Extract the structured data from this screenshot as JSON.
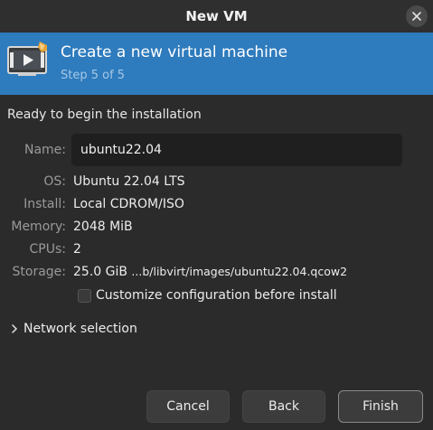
{
  "window": {
    "title": "New VM",
    "close_icon": "close-icon"
  },
  "banner": {
    "title": "Create a new virtual machine",
    "step": "Step 5 of 5",
    "icon": "virtual-machine-monitor-icon",
    "color": "#2e7bbd"
  },
  "summary": {
    "heading": "Ready to begin the installation",
    "name_label": "Name:",
    "name_value": "ubuntu22.04",
    "os_label": "OS:",
    "os_value": "Ubuntu 22.04 LTS",
    "install_label": "Install:",
    "install_value": "Local CDROM/ISO",
    "memory_label": "Memory:",
    "memory_value": "2048 MiB",
    "cpus_label": "CPUs:",
    "cpus_value": "2",
    "storage_label": "Storage:",
    "storage_size": "25.0 GiB",
    "storage_path": "...b/libvirt/images/ubuntu22.04.qcow2"
  },
  "options": {
    "customize_label": "Customize configuration before install",
    "customize_checked": false,
    "network_label": "Network selection",
    "network_expanded": false
  },
  "buttons": {
    "cancel": "Cancel",
    "back": "Back",
    "finish": "Finish"
  }
}
